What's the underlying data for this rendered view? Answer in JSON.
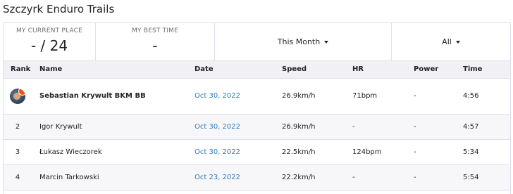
{
  "title": "Szczyrk Enduro Trails",
  "stats": {
    "current_place_label": "MY CURRENT PLACE",
    "current_place_value": "- / 24",
    "best_time_label": "MY BEST TIME",
    "best_time_value": "-"
  },
  "filters": {
    "period": "This Month",
    "gender": "All"
  },
  "table": {
    "headers": {
      "rank": "Rank",
      "name": "Name",
      "date": "Date",
      "speed": "Speed",
      "hr": "HR",
      "power": "Power",
      "time": "Time"
    },
    "rows": [
      {
        "rank": "",
        "name": "Sebastian Krywult BKM BB",
        "date": "Oct 30, 2022",
        "speed": "26.9km/h",
        "hr": "71bpm",
        "power": "-",
        "time": "4:56"
      },
      {
        "rank": "2",
        "name": "Igor Krywult",
        "date": "Oct 30, 2022",
        "speed": "26.9km/h",
        "hr": "-",
        "power": "-",
        "time": "4:57"
      },
      {
        "rank": "3",
        "name": "Łukasz Wieczorek",
        "date": "Oct 30, 2022",
        "speed": "22.5km/h",
        "hr": "124bpm",
        "power": "-",
        "time": "5:34"
      },
      {
        "rank": "4",
        "name": "Marcin Tarkowski",
        "date": "Oct 23, 2022",
        "speed": "22.2km/h",
        "hr": "-",
        "power": "-",
        "time": "5:54"
      }
    ]
  },
  "colors": {
    "link": "#2f7bbf",
    "header_bg": "#f0f0f5",
    "border": "#dfdfe8",
    "accent": "#fc5200"
  }
}
